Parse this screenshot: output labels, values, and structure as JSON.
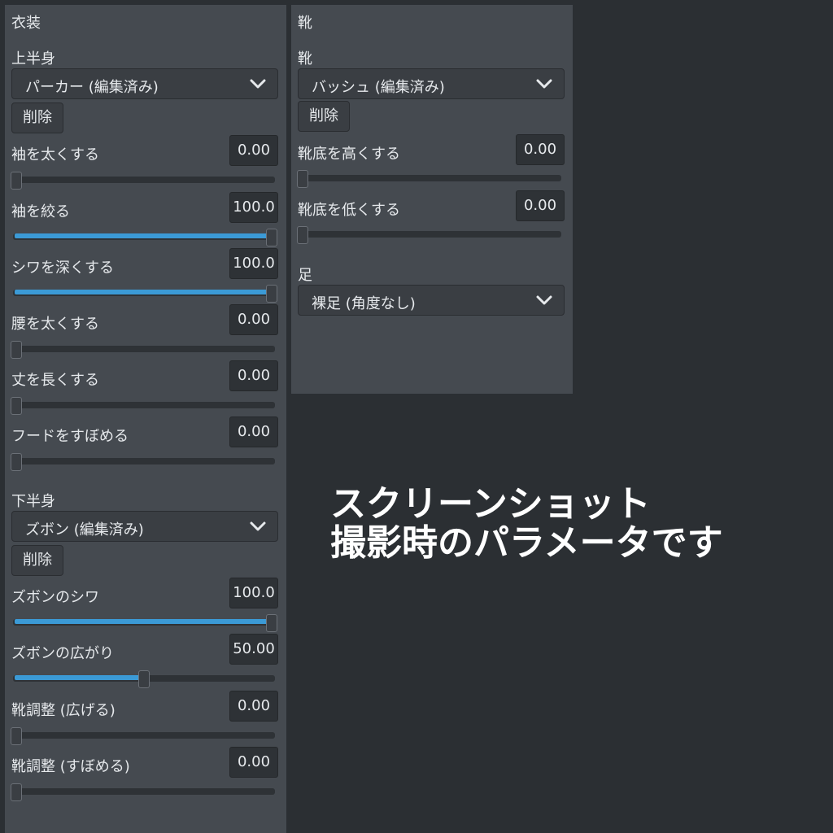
{
  "costume_panel": {
    "title": "衣装",
    "upper_body": {
      "label": "上半身",
      "selected": "パーカー (編集済み)",
      "delete_label": "削除",
      "params": [
        {
          "label": "袖を太くする",
          "value": "0.00",
          "fraction": 0.0
        },
        {
          "label": "袖を絞る",
          "value": "100.0",
          "fraction": 1.0
        },
        {
          "label": "シワを深くする",
          "value": "100.0",
          "fraction": 1.0
        },
        {
          "label": "腰を太くする",
          "value": "0.00",
          "fraction": 0.0
        },
        {
          "label": "丈を長くする",
          "value": "0.00",
          "fraction": 0.0
        },
        {
          "label": "フードをすぼめる",
          "value": "0.00",
          "fraction": 0.0
        }
      ]
    },
    "lower_body": {
      "label": "下半身",
      "selected": "ズボン (編集済み)",
      "delete_label": "削除",
      "params": [
        {
          "label": "ズボンのシワ",
          "value": "100.0",
          "fraction": 1.0
        },
        {
          "label": "ズボンの広がり",
          "value": "50.00",
          "fraction": 0.5
        },
        {
          "label": "靴調整 (広げる)",
          "value": "0.00",
          "fraction": 0.0
        },
        {
          "label": "靴調整 (すぼめる)",
          "value": "0.00",
          "fraction": 0.0
        }
      ]
    }
  },
  "shoes_panel": {
    "title": "靴",
    "shoes": {
      "label": "靴",
      "selected": "バッシュ (編集済み)",
      "delete_label": "削除",
      "params": [
        {
          "label": "靴底を高くする",
          "value": "0.00",
          "fraction": 0.0
        },
        {
          "label": "靴底を低くする",
          "value": "0.00",
          "fraction": 0.0
        }
      ]
    },
    "feet": {
      "label": "足",
      "selected": "裸足 (角度なし)"
    }
  },
  "overlay": {
    "line1": "スクリーンショット",
    "line2": "撮影時のパラメータです"
  },
  "colors": {
    "background": "#2b2f33",
    "panel": "#454a50",
    "slider_fill": "#3b9ad6"
  },
  "icons": {
    "dropdown": "chevron-down-icon"
  }
}
